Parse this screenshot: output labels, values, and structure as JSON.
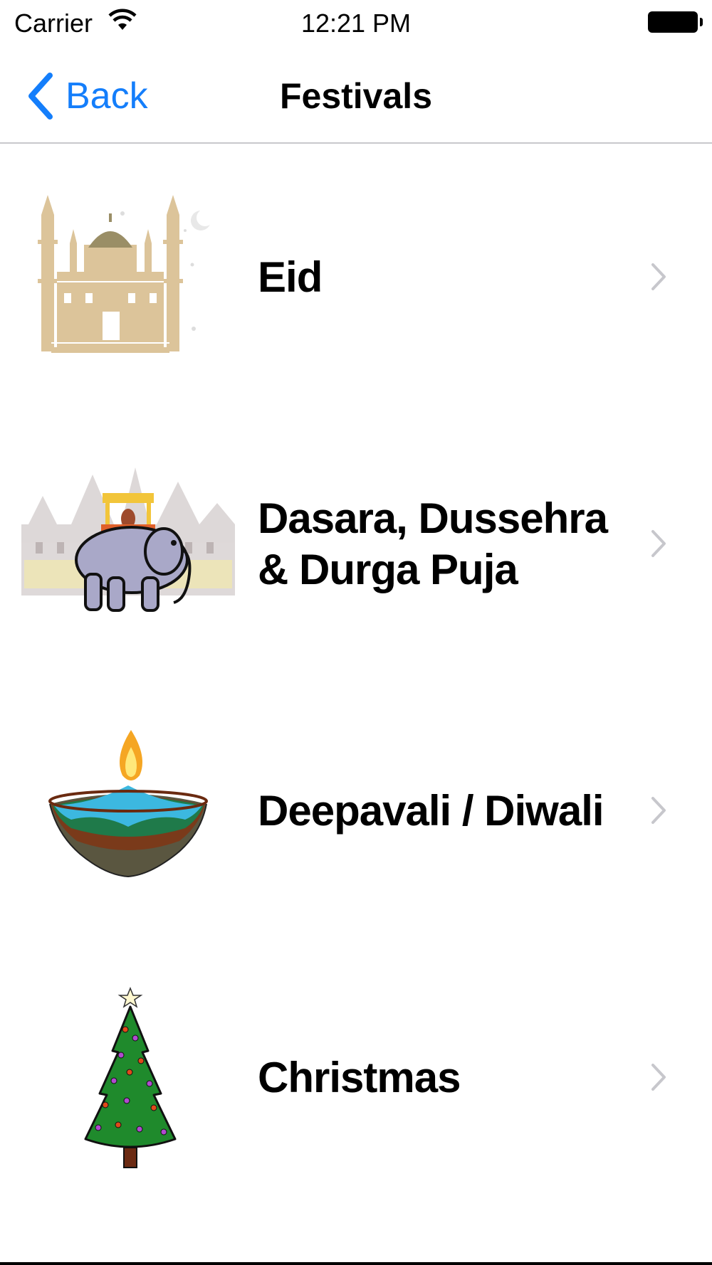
{
  "status_bar": {
    "carrier": "Carrier",
    "time": "12:21 PM"
  },
  "nav": {
    "back_label": "Back",
    "title": "Festivals"
  },
  "festivals": [
    {
      "label": "Eid",
      "icon": "mosque-icon"
    },
    {
      "label": "Dasara, Dussehra & Durga Puja",
      "icon": "elephant-palace-icon"
    },
    {
      "label": "Deepavali / Diwali",
      "icon": "diya-lamp-icon"
    },
    {
      "label": "Christmas",
      "icon": "christmas-tree-icon"
    }
  ],
  "colors": {
    "accent": "#147efb",
    "chevron": "#c7c7cc",
    "separator": "#c8c8cc"
  }
}
